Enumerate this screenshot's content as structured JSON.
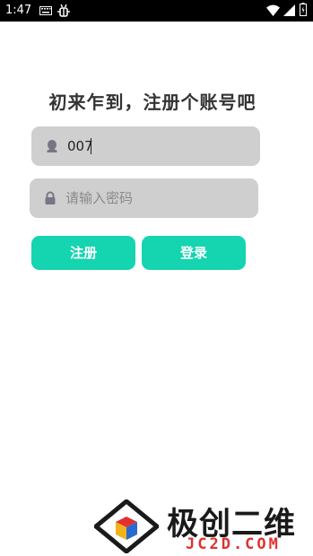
{
  "status_bar": {
    "time": "1:47",
    "left_icons": [
      "keyboard-icon",
      "bug-icon"
    ],
    "right_icons": [
      "wifi-icon",
      "signal-icon",
      "battery-icon"
    ]
  },
  "title": "初来乍到，注册个账号吧",
  "account_field": {
    "icon": "user-icon",
    "value": "007"
  },
  "password_field": {
    "icon": "lock-icon",
    "value": "",
    "placeholder": "请输入密码"
  },
  "buttons": {
    "register": "注册",
    "login": "登录"
  },
  "watermark": {
    "name_cn": "极创二维",
    "name_en": "JC2D.COM"
  },
  "colors": {
    "accent": "#15d4b0",
    "field_bg": "#cfcfcf",
    "watermark_red": "#e03030"
  }
}
